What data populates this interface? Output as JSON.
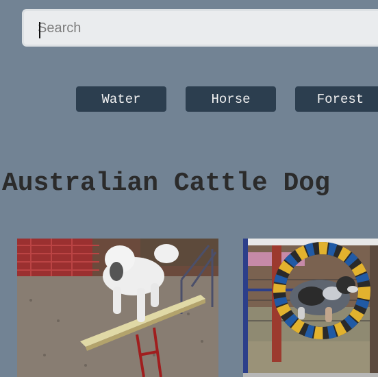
{
  "search": {
    "placeholder": "Search",
    "value": ""
  },
  "filters": [
    {
      "label": "Water"
    },
    {
      "label": "Horse"
    },
    {
      "label": "Forest"
    }
  ],
  "page_title": "Australian Cattle Dog",
  "gallery": [
    {
      "subject": "poodle-on-seesaw"
    },
    {
      "subject": "dog-jumping-through-tire"
    }
  ],
  "colors": {
    "background": "#728394",
    "button": "#2c3e4f",
    "button_text": "#f2f2f2",
    "title_text": "#2b2b2b"
  }
}
